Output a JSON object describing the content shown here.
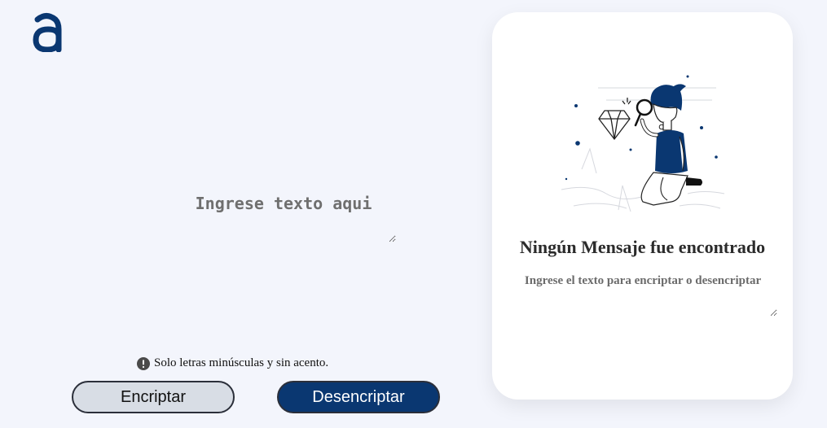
{
  "brand": {
    "logo_icon": "alura-logo-icon",
    "accent": "#0a3771"
  },
  "input": {
    "placeholder": "Ingrese texto aqui",
    "value": ""
  },
  "notice": {
    "icon": "exclamation-circle-icon",
    "text": "Solo letras minúsculas y sin acento."
  },
  "buttons": {
    "encrypt_label": "Encriptar",
    "decrypt_label": "Desencriptar"
  },
  "output": {
    "illustration": "person-magnifier-diamond-illustration",
    "title": "Ningún Mensaje fue encontrado",
    "placeholder": "Ingrese el texto para encriptar o desencriptar",
    "value": ""
  }
}
